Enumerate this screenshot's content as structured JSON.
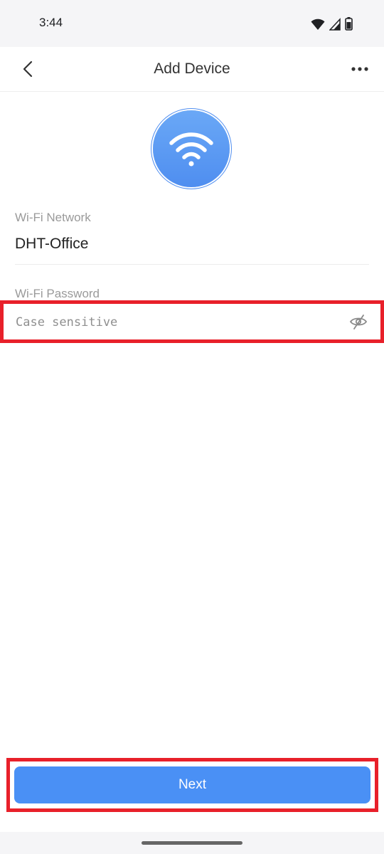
{
  "status_bar": {
    "time": "3:44",
    "icons": [
      "wifi-icon",
      "signal-icon",
      "battery-icon"
    ]
  },
  "header": {
    "title": "Add Device",
    "back_icon": "chevron-left-icon",
    "more_icon": "more-horizontal-icon"
  },
  "hero": {
    "icon": "wifi-icon",
    "accent_color": "#4f8ef0"
  },
  "form": {
    "network_label": "Wi-Fi Network",
    "network_value": "DHT-Office",
    "password_label": "Wi-Fi Password",
    "password_placeholder": "Case sensitive",
    "password_value": "",
    "visibility_icon": "eye-off-icon"
  },
  "actions": {
    "next_label": "Next",
    "next_color": "#4a90f5"
  }
}
